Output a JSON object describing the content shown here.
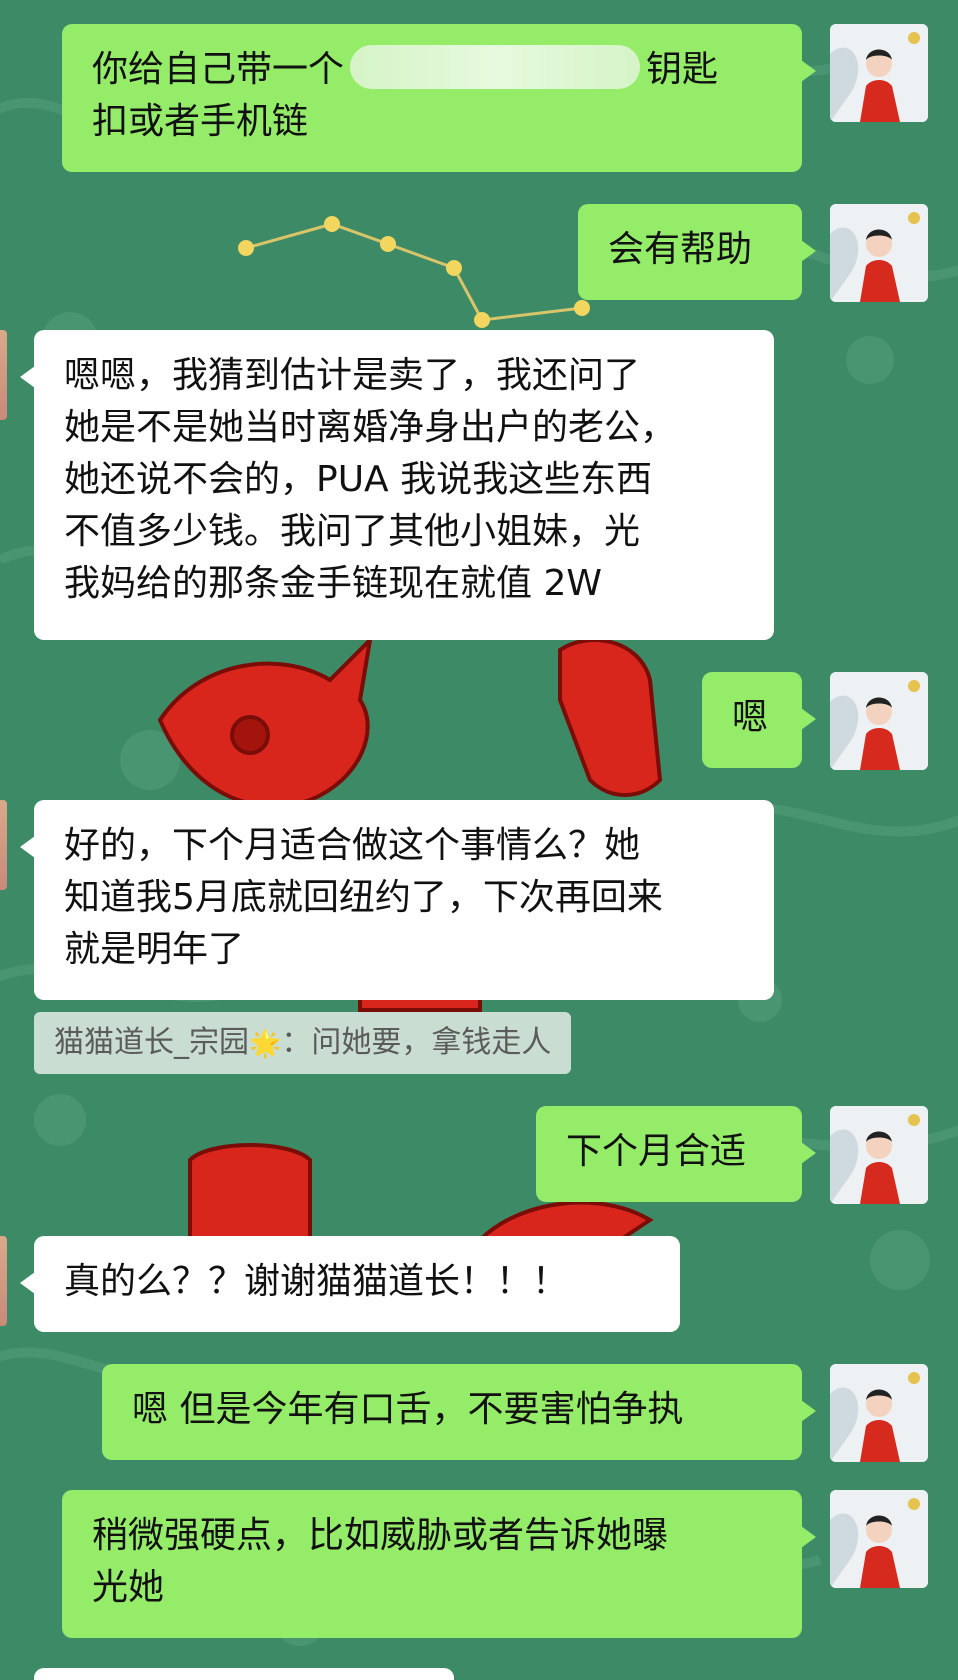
{
  "colors": {
    "chat_background": "#3c8a66",
    "outgoing_bubble": "#95ec69",
    "incoming_bubble": "#ffffff",
    "quote_background": "#d6e4dc",
    "decor_red": "#d8261c"
  },
  "icons": {
    "avatar": "avatar-icon",
    "quote_emoji": "star-icon",
    "redaction": "redaction-blur"
  },
  "messages": [
    {
      "side": "out",
      "lines": [
        "你给自己带一个",
        "钥匙",
        "扣或者手机链"
      ],
      "has_redaction": true
    },
    {
      "side": "out",
      "lines": [
        "会有帮助"
      ]
    },
    {
      "side": "in",
      "lines": [
        "嗯嗯，我猜到估计是卖了，我还问了",
        "她是不是她当时离婚净身出户的老公，",
        "她还说不会的，PUA 我说我这些东西",
        "不值多少钱。我问了其他小姐妹，光",
        "我妈给的那条金手链现在就值 2W"
      ]
    },
    {
      "side": "out",
      "lines": [
        "嗯"
      ]
    },
    {
      "side": "in",
      "lines": [
        "好的，下个月适合做这个事情么？她",
        "知道我5月底就回纽约了，下次再回来",
        "就是明年了"
      ]
    },
    {
      "side": "out",
      "lines": [
        "下个月合适"
      ]
    },
    {
      "side": "in",
      "lines": [
        "真的么？？谢谢猫猫道长！！！"
      ]
    },
    {
      "side": "out",
      "lines": [
        "嗯 但是今年有口舌，不要害怕争执"
      ]
    },
    {
      "side": "out",
      "lines": [
        "稍微强硬点，比如威胁或者告诉她曝",
        "光她"
      ]
    }
  ],
  "quote": {
    "author": "猫猫道长_宗园",
    "emoji": "🌟",
    "separator": "：",
    "text": "问她要，拿钱走人"
  }
}
